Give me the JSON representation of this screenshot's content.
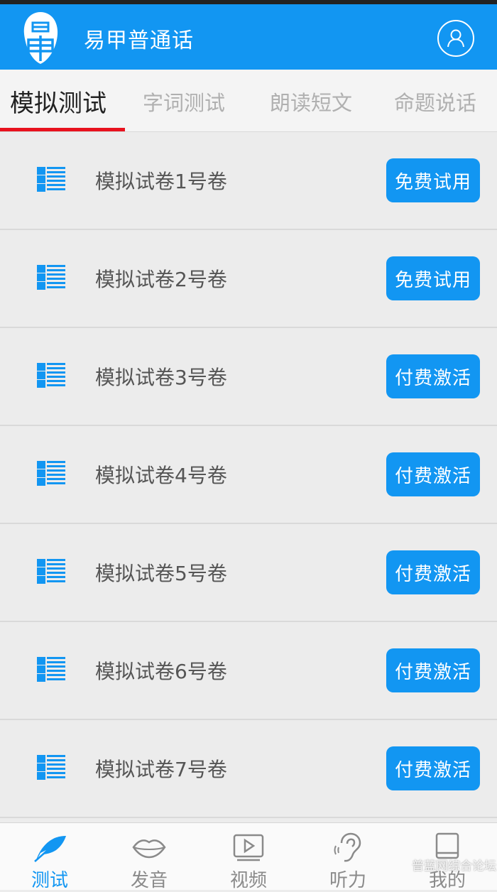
{
  "header": {
    "title": "易甲普通话",
    "logo_icon": "yijia-logo",
    "user_icon": "user-icon"
  },
  "tabs": [
    {
      "label": "模拟测试",
      "active": true
    },
    {
      "label": "字词测试",
      "active": false
    },
    {
      "label": "朗读短文",
      "active": false
    },
    {
      "label": "命题说话",
      "active": false
    }
  ],
  "papers": [
    {
      "label": "模拟试卷1号卷",
      "action": "免费试用"
    },
    {
      "label": "模拟试卷2号卷",
      "action": "免费试用"
    },
    {
      "label": "模拟试卷3号卷",
      "action": "付费激活"
    },
    {
      "label": "模拟试卷4号卷",
      "action": "付费激活"
    },
    {
      "label": "模拟试卷5号卷",
      "action": "付费激活"
    },
    {
      "label": "模拟试卷6号卷",
      "action": "付费激活"
    },
    {
      "label": "模拟试卷7号卷",
      "action": "付费激活"
    }
  ],
  "bottom_nav": [
    {
      "label": "测试",
      "icon": "feather-icon",
      "active": true
    },
    {
      "label": "发音",
      "icon": "lips-icon",
      "active": false
    },
    {
      "label": "视频",
      "icon": "video-icon",
      "active": false
    },
    {
      "label": "听力",
      "icon": "ear-icon",
      "active": false
    },
    {
      "label": "我的",
      "icon": "book-icon",
      "active": false
    }
  ],
  "watermark": "普蓝网综合论坛",
  "colors": {
    "primary": "#1296f2",
    "tab_indicator": "#e8121e",
    "background": "#ececec"
  }
}
